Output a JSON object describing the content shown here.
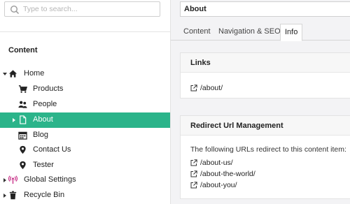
{
  "search": {
    "placeholder": "Type to search..."
  },
  "tree": {
    "section_title": "Content",
    "items": [
      {
        "label": "Home",
        "icon": "home-icon"
      },
      {
        "label": "Products",
        "icon": "cart-icon"
      },
      {
        "label": "People",
        "icon": "people-icon"
      },
      {
        "label": "About",
        "icon": "document-icon"
      },
      {
        "label": "Blog",
        "icon": "calendar-icon"
      },
      {
        "label": "Contact Us",
        "icon": "location-pin-icon"
      },
      {
        "label": "Tester",
        "icon": "location-pin-icon"
      },
      {
        "label": "Global Settings",
        "icon": "broadcast-icon"
      },
      {
        "label": "Recycle Bin",
        "icon": "trash-icon"
      }
    ],
    "active_color": "#2bb48a"
  },
  "editor": {
    "name_value": "About",
    "tabs": [
      {
        "label": "Content"
      },
      {
        "label": "Navigation & SEO"
      },
      {
        "label": "Info",
        "active": true
      }
    ],
    "links_card": {
      "title": "Links",
      "links": [
        "/about/"
      ]
    },
    "redirect_card": {
      "title": "Redirect Url Management",
      "description": "The following URLs redirect to this content item:",
      "links": [
        "/about-us/",
        "/about-the-world/",
        "/about-you/"
      ]
    }
  }
}
